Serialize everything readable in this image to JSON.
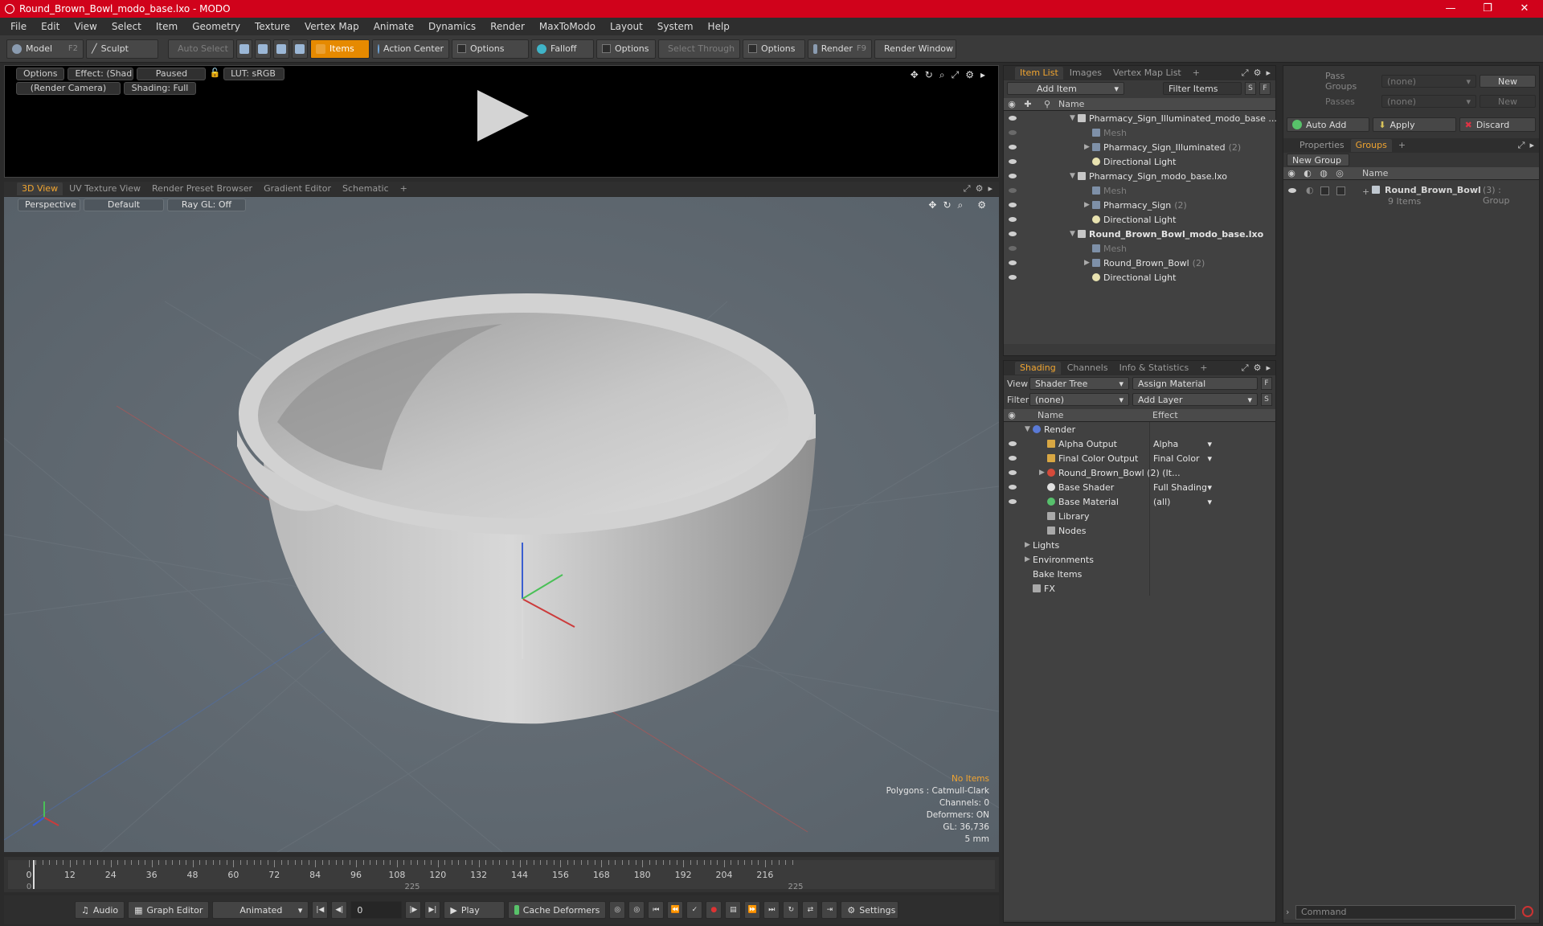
{
  "window": {
    "title": "Round_Brown_Bowl_modo_base.lxo - MODO",
    "minimize": "—",
    "maximize": "❐",
    "close": "✕"
  },
  "menu": [
    "File",
    "Edit",
    "View",
    "Select",
    "Item",
    "Geometry",
    "Texture",
    "Vertex Map",
    "Animate",
    "Dynamics",
    "Render",
    "MaxToModo",
    "Layout",
    "System",
    "Help"
  ],
  "toolbar": {
    "model": "Model",
    "model_key": "F2",
    "sculpt": "Sculpt",
    "auto_select": "Auto Select",
    "items": "Items",
    "action_center": "Action Center",
    "options1": "Options",
    "falloff": "Falloff",
    "options2": "Options",
    "select_through": "Select Through",
    "options3": "Options",
    "render": "Render",
    "render_key": "F9",
    "render_window": "Render Window"
  },
  "preview": {
    "options": "Options",
    "effect": "Effect: (Shadi...",
    "paused": "Paused",
    "lut": "LUT: sRGB",
    "camera": "(Render Camera)",
    "shading": "Shading: Full"
  },
  "viewport_tabs": [
    "3D View",
    "UV Texture View",
    "Render Preset Browser",
    "Gradient Editor",
    "Schematic",
    "+"
  ],
  "viewport": {
    "perspective": "Perspective",
    "default": "Default",
    "raygl": "Ray GL: Off"
  },
  "hud": {
    "no_items": "No Items",
    "polygons": "Polygons : Catmull-Clark",
    "channels": "Channels: 0",
    "deformers": "Deformers: ON",
    "gl": "GL: 36,736",
    "unit": "5 mm"
  },
  "timeline": {
    "top_labels": [
      "0",
      "12",
      "24",
      "36",
      "48",
      "60",
      "72",
      "84",
      "96",
      "108",
      "120",
      "132",
      "144",
      "156",
      "168",
      "180",
      "192",
      "204",
      "216"
    ],
    "bottom_left": "0",
    "bottom_mid": "225",
    "bottom_right": "225"
  },
  "bottom": {
    "audio": "Audio",
    "graph_editor": "Graph Editor",
    "animated": "Animated",
    "frame": "0",
    "play": "Play",
    "cache_deformers": "Cache Deformers",
    "settings": "Settings"
  },
  "item_list": {
    "tabs": [
      "Item List",
      "Images",
      "Vertex Map List",
      "+"
    ],
    "add_item": "Add Item",
    "filter": "Filter Items",
    "s": "S",
    "f": "F",
    "col_name": "Name",
    "rows": [
      {
        "label": "Pharmacy_Sign_Illuminated_modo_base ...",
        "count": "",
        "indent": 0,
        "kind": "scene",
        "exp": "▼",
        "style": ""
      },
      {
        "label": "Mesh",
        "count": "",
        "indent": 1,
        "kind": "mesh",
        "exp": "",
        "style": "sub"
      },
      {
        "label": "Pharmacy_Sign_Illuminated",
        "count": "(2)",
        "indent": 1,
        "kind": "mesh",
        "exp": "▶",
        "style": ""
      },
      {
        "label": "Directional Light",
        "count": "",
        "indent": 1,
        "kind": "light",
        "exp": "",
        "style": ""
      },
      {
        "label": "Pharmacy_Sign_modo_base.lxo",
        "count": "",
        "indent": 0,
        "kind": "scene",
        "exp": "▼",
        "style": ""
      },
      {
        "label": "Mesh",
        "count": "",
        "indent": 1,
        "kind": "mesh",
        "exp": "",
        "style": "sub"
      },
      {
        "label": "Pharmacy_Sign",
        "count": "(2)",
        "indent": 1,
        "kind": "mesh",
        "exp": "▶",
        "style": ""
      },
      {
        "label": "Directional Light",
        "count": "",
        "indent": 1,
        "kind": "light",
        "exp": "",
        "style": ""
      },
      {
        "label": "Round_Brown_Bowl_modo_base.lxo",
        "count": "",
        "indent": 0,
        "kind": "scene",
        "exp": "▼",
        "style": "bold"
      },
      {
        "label": "Mesh",
        "count": "",
        "indent": 1,
        "kind": "mesh",
        "exp": "",
        "style": "sub"
      },
      {
        "label": "Round_Brown_Bowl",
        "count": "(2)",
        "indent": 1,
        "kind": "mesh",
        "exp": "▶",
        "style": ""
      },
      {
        "label": "Directional Light",
        "count": "",
        "indent": 1,
        "kind": "light",
        "exp": "",
        "style": ""
      }
    ]
  },
  "shading": {
    "tabs": [
      "Shading",
      "Channels",
      "Info & Statistics",
      "+"
    ],
    "view_label": "View",
    "view_value": "Shader Tree",
    "assign_material": "Assign Material",
    "filter_label": "Filter",
    "filter_value": "(none)",
    "add_layer": "Add Layer",
    "col_name": "Name",
    "col_effect": "Effect",
    "rows": [
      {
        "label": "Render",
        "effect": "",
        "indent": 0,
        "kind": "blue",
        "exp": "▼",
        "eye": false
      },
      {
        "label": "Alpha Output",
        "effect": "Alpha",
        "indent": 1,
        "kind": "gold",
        "exp": "",
        "eye": true
      },
      {
        "label": "Final Color Output",
        "effect": "Final Color",
        "indent": 1,
        "kind": "gold",
        "exp": "",
        "eye": true
      },
      {
        "label": "Round_Brown_Bowl (2) (It...",
        "effect": "",
        "indent": 1,
        "kind": "red",
        "exp": "▶",
        "eye": true
      },
      {
        "label": "Base Shader",
        "effect": "Full Shading",
        "indent": 1,
        "kind": "white",
        "exp": "",
        "eye": true
      },
      {
        "label": "Base Material",
        "effect": "(all)",
        "indent": 1,
        "kind": "green",
        "exp": "",
        "eye": true
      },
      {
        "label": "Library",
        "effect": "",
        "indent": 1,
        "kind": "folder",
        "exp": "",
        "eye": false
      },
      {
        "label": "Nodes",
        "effect": "",
        "indent": 1,
        "kind": "folder",
        "exp": "",
        "eye": false
      },
      {
        "label": "Lights",
        "effect": "",
        "indent": 0,
        "kind": "none",
        "exp": "▶",
        "eye": false
      },
      {
        "label": "Environments",
        "effect": "",
        "indent": 0,
        "kind": "none",
        "exp": "▶",
        "eye": false
      },
      {
        "label": "Bake Items",
        "effect": "",
        "indent": 0,
        "kind": "none",
        "exp": "",
        "eye": false
      },
      {
        "label": "FX",
        "effect": "",
        "indent": 0,
        "kind": "folder",
        "exp": "",
        "eye": false
      }
    ]
  },
  "groups_panel": {
    "pass_groups": "Pass Groups",
    "passes": "Passes",
    "none1": "(none)",
    "none2": "(none)",
    "new1": "New",
    "new2": "New",
    "auto_add": "Auto Add",
    "apply": "Apply",
    "discard": "Discard",
    "tabs": [
      "Properties",
      "Groups",
      "+"
    ],
    "new_group": "New Group",
    "col_name": "Name",
    "group_name": "Round_Brown_Bowl",
    "group_count": "(3) : Group",
    "group_items": "9 Items"
  },
  "command": {
    "placeholder": "Command"
  }
}
